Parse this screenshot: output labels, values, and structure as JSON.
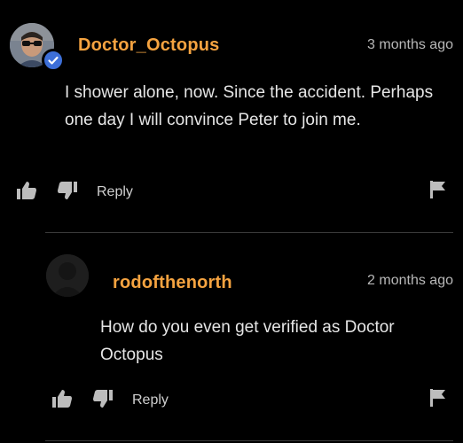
{
  "comments": [
    {
      "username": "Doctor_Octopus",
      "timestamp": "3 months ago",
      "text": "I shower alone, now. Since the accident. Perhaps one day I will convince Peter to join me.",
      "verified": true,
      "reply_label": "Reply",
      "icons": [
        "thumbs-up-icon",
        "thumbs-down-icon",
        "flag-icon",
        "verified-check-icon"
      ]
    },
    {
      "username": "rodofthenorth",
      "timestamp": "2 months ago",
      "text": "How do you even get verified as Doctor Octopus",
      "verified": false,
      "reply_label": "Reply",
      "icons": [
        "thumbs-up-icon",
        "thumbs-down-icon",
        "flag-icon"
      ]
    }
  ],
  "colors": {
    "background": "#000000",
    "username": "#f5a340",
    "timestamp": "#b8b8b8",
    "text": "#e6e6e6",
    "icon": "#bdbdbd",
    "verified_badge": "#3d6fd8"
  }
}
